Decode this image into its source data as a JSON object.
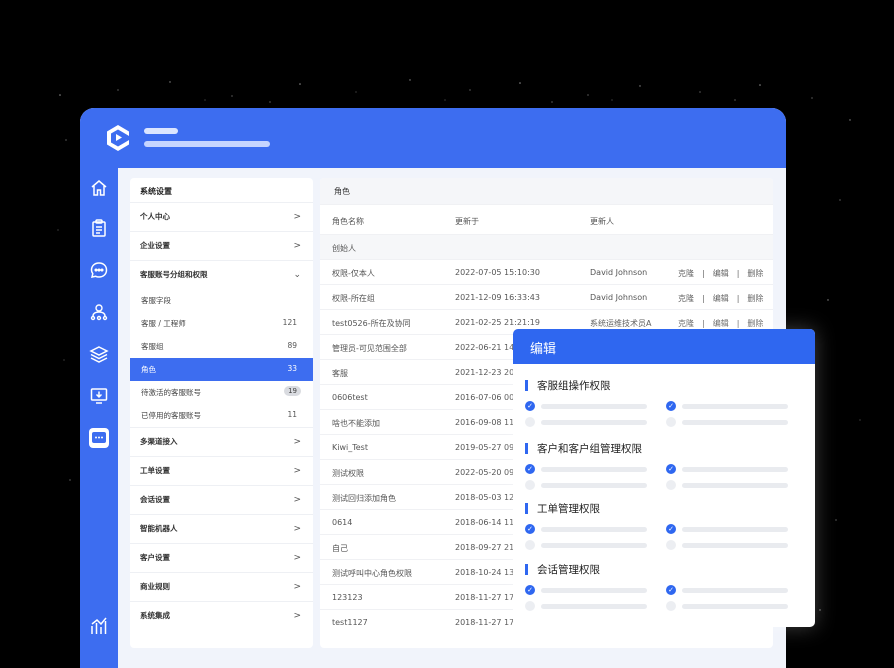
{
  "sidebar_icons": [
    "home-icon",
    "clipboard-icon",
    "chat-bubble-icon",
    "user-network-icon",
    "layers-icon",
    "monitor-download-icon",
    "message-square-icon",
    "chart-icon"
  ],
  "nav": {
    "title": "系统设置",
    "sections": [
      {
        "label": "个人中心",
        "chevron": ">"
      },
      {
        "label": "企业设置",
        "chevron": ">"
      },
      {
        "label": "客服账号分组和权限",
        "chevron": "⌄"
      }
    ],
    "sub_items": [
      {
        "label": "客服字段",
        "count": ""
      },
      {
        "label": "客服 / 工程师",
        "count": "121"
      },
      {
        "label": "客服组",
        "count": "89"
      },
      {
        "label": "角色",
        "count": "33"
      },
      {
        "label": "待激活的客服账号",
        "count": "19"
      },
      {
        "label": "已停用的客服账号",
        "count": "11"
      }
    ],
    "sections_after": [
      {
        "label": "多渠道接入",
        "chevron": ">"
      },
      {
        "label": "工单设置",
        "chevron": ">"
      },
      {
        "label": "会话设置",
        "chevron": ">"
      },
      {
        "label": "智能机器人",
        "chevron": ">"
      },
      {
        "label": "客户设置",
        "chevron": ">"
      },
      {
        "label": "商业规则",
        "chevron": ">"
      },
      {
        "label": "系统集成",
        "chevron": ">"
      }
    ]
  },
  "main": {
    "title": "角色",
    "columns": [
      "角色名称",
      "更新于",
      "更新人"
    ],
    "group_label": "创始人",
    "actions": "克隆　|　编辑　|　删除",
    "rows": [
      {
        "name": "权限-仅本人",
        "updated": "2022-07-05 15:10:30",
        "by": "David Johnson"
      },
      {
        "name": "权限-所在组",
        "updated": "2021-12-09 16:33:43",
        "by": "David Johnson"
      },
      {
        "name": "test0526-所在及协同",
        "updated": "2021-02-25 21:21:19",
        "by": "系统运维技术员A"
      },
      {
        "name": "管理员-可见范围全部",
        "updated": "2022-06-21 14:",
        "by": ""
      },
      {
        "name": "客服",
        "updated": "2021-12-23 20:",
        "by": ""
      },
      {
        "name": "0606test",
        "updated": "2016-07-06 00:",
        "by": ""
      },
      {
        "name": "啥也不能添加",
        "updated": "2016-09-08 11:",
        "by": ""
      },
      {
        "name": "Kiwi_Test",
        "updated": "2019-05-27 09:",
        "by": ""
      },
      {
        "name": "测试权限",
        "updated": "2022-05-20 09:",
        "by": ""
      },
      {
        "name": "测试回归添加角色",
        "updated": "2018-05-03 12:",
        "by": ""
      },
      {
        "name": "0614",
        "updated": "2018-06-14 11:",
        "by": ""
      },
      {
        "name": "自己",
        "updated": "2018-09-27 21:",
        "by": ""
      },
      {
        "name": "测试呼叫中心角色权限",
        "updated": "2018-10-24 13:",
        "by": ""
      },
      {
        "name": "123123",
        "updated": "2018-11-27 17:",
        "by": ""
      },
      {
        "name": "test1127",
        "updated": "2018-11-27 17:",
        "by": ""
      }
    ]
  },
  "modal": {
    "title": "编辑",
    "groups": [
      "客服组操作权限",
      "客户和客户组管理权限",
      "工单管理权限",
      "会话管理权限"
    ],
    "check_glyph": "✓"
  },
  "colors": {
    "primary": "#3d6df0",
    "modal_header": "#2f67f0"
  }
}
